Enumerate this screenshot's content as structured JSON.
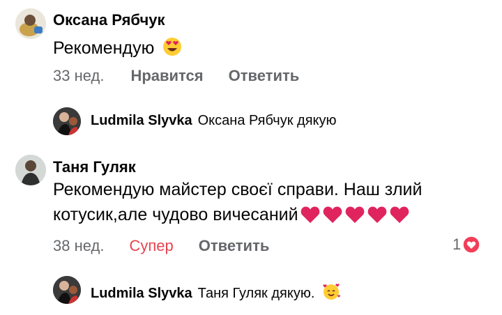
{
  "comments": [
    {
      "author": "Оксана Рябчук",
      "text": "Рекомендую",
      "emoji_icon": "heart-eyes-emoji",
      "time": "33 нед.",
      "like_label": "Нравится",
      "reply_label": "Ответить",
      "reply": {
        "author": "Ludmila Slyvka",
        "text": "Оксана Рябчук дякую"
      }
    },
    {
      "author": "Таня Гуляк",
      "text_line1": "Рекомендую майстер своєї справи. Наш злий",
      "text_line2": "котусик,але чудово вичесаний",
      "hearts_icon": "red-heart-emoji",
      "hearts_count": 5,
      "time": "38 нед.",
      "reaction_label": "Супер",
      "reply_label": "Ответить",
      "reaction_count": "1",
      "reaction_icon": "love-reaction-icon",
      "reply": {
        "author": "Ludmila Slyvka",
        "text": "Таня Гуляк дякую.",
        "emoji_icon": "smiling-face-with-hearts-emoji"
      }
    }
  ],
  "colors": {
    "meta_gray": "#65676b",
    "super_red": "#e8434f",
    "heart_red": "#e0245e"
  }
}
